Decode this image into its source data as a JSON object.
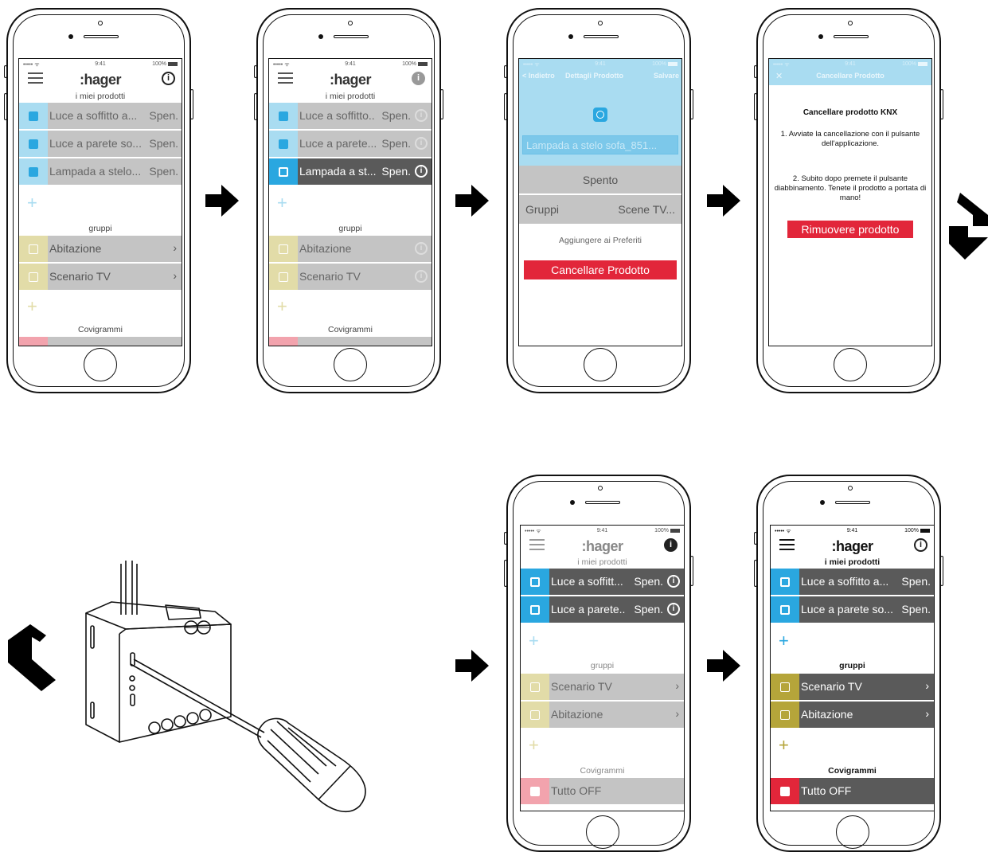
{
  "status": {
    "signal": "••••• ᯤ",
    "time": "9:41",
    "battery": "100%"
  },
  "logo": ":hager",
  "info_glyph": "i",
  "sections": {
    "products": "i miei prodotti",
    "groups": "gruppi",
    "scenes": "Covigrammi"
  },
  "plus_glyph": "+",
  "chevron_glyph": "›",
  "colors": {
    "blue": "#2aa7e0",
    "light_blue": "#a9dcf1",
    "olive": "#b5a53a",
    "light_olive": "#e2dca8",
    "red": "#e2263a",
    "light_red": "#f2a3ad",
    "dark_row": "#5a5a5a",
    "light_row": "#c4c4c4"
  },
  "phone1": {
    "products": [
      {
        "name": "Luce a soffitto a...",
        "state": "Spen."
      },
      {
        "name": "Luce a parete so...",
        "state": "Spen."
      },
      {
        "name": "Lampada a stelo...",
        "state": "Spen."
      }
    ],
    "groups": [
      "Abitazione",
      "Scenario TV"
    ]
  },
  "phone2": {
    "products": [
      {
        "name": "Luce a soffitto..",
        "state": "Spen."
      },
      {
        "name": "Luce a parete...",
        "state": "Spen."
      },
      {
        "name": "Lampada a st...",
        "state": "Spen."
      }
    ],
    "groups": [
      "Abitazione",
      "Scenario TV"
    ]
  },
  "phone3": {
    "nav": {
      "back": "< Indietro",
      "title": "Dettagli Prodotto",
      "save": "Salvare"
    },
    "product_name": "Lampada a stelo sofa_851...",
    "state": "Spento",
    "group_label": "Gruppi",
    "group_value": "Scene TV...",
    "favorites": "Aggiungere ai Preferiti",
    "delete_button": "Cancellare Prodotto"
  },
  "phone4": {
    "nav": {
      "close": "✕",
      "title": "Cancellare Prodotto"
    },
    "heading": "Cancellare prodotto KNX",
    "step1": "1. Avviate la cancellazione con il pulsante dell'applicazione.",
    "step2": "2. Subito dopo premete il pulsante diabbinamento. Tenete il prodotto a portata di mano!",
    "remove_button": "Rimuovere prodotto"
  },
  "phone5": {
    "products": [
      {
        "name": "Luce a soffitt...",
        "state": "Spen."
      },
      {
        "name": "Luce a parete..",
        "state": "Spen."
      }
    ],
    "groups": [
      "Scenario TV",
      "Abitazione"
    ],
    "scene": "Tutto OFF"
  },
  "phone6": {
    "products": [
      {
        "name": "Luce a soffitto a...",
        "state": "Spen."
      },
      {
        "name": "Luce a parete so...",
        "state": "Spen."
      }
    ],
    "groups": [
      "Scenario TV",
      "Abitazione"
    ],
    "scene": "Tutto OFF"
  }
}
